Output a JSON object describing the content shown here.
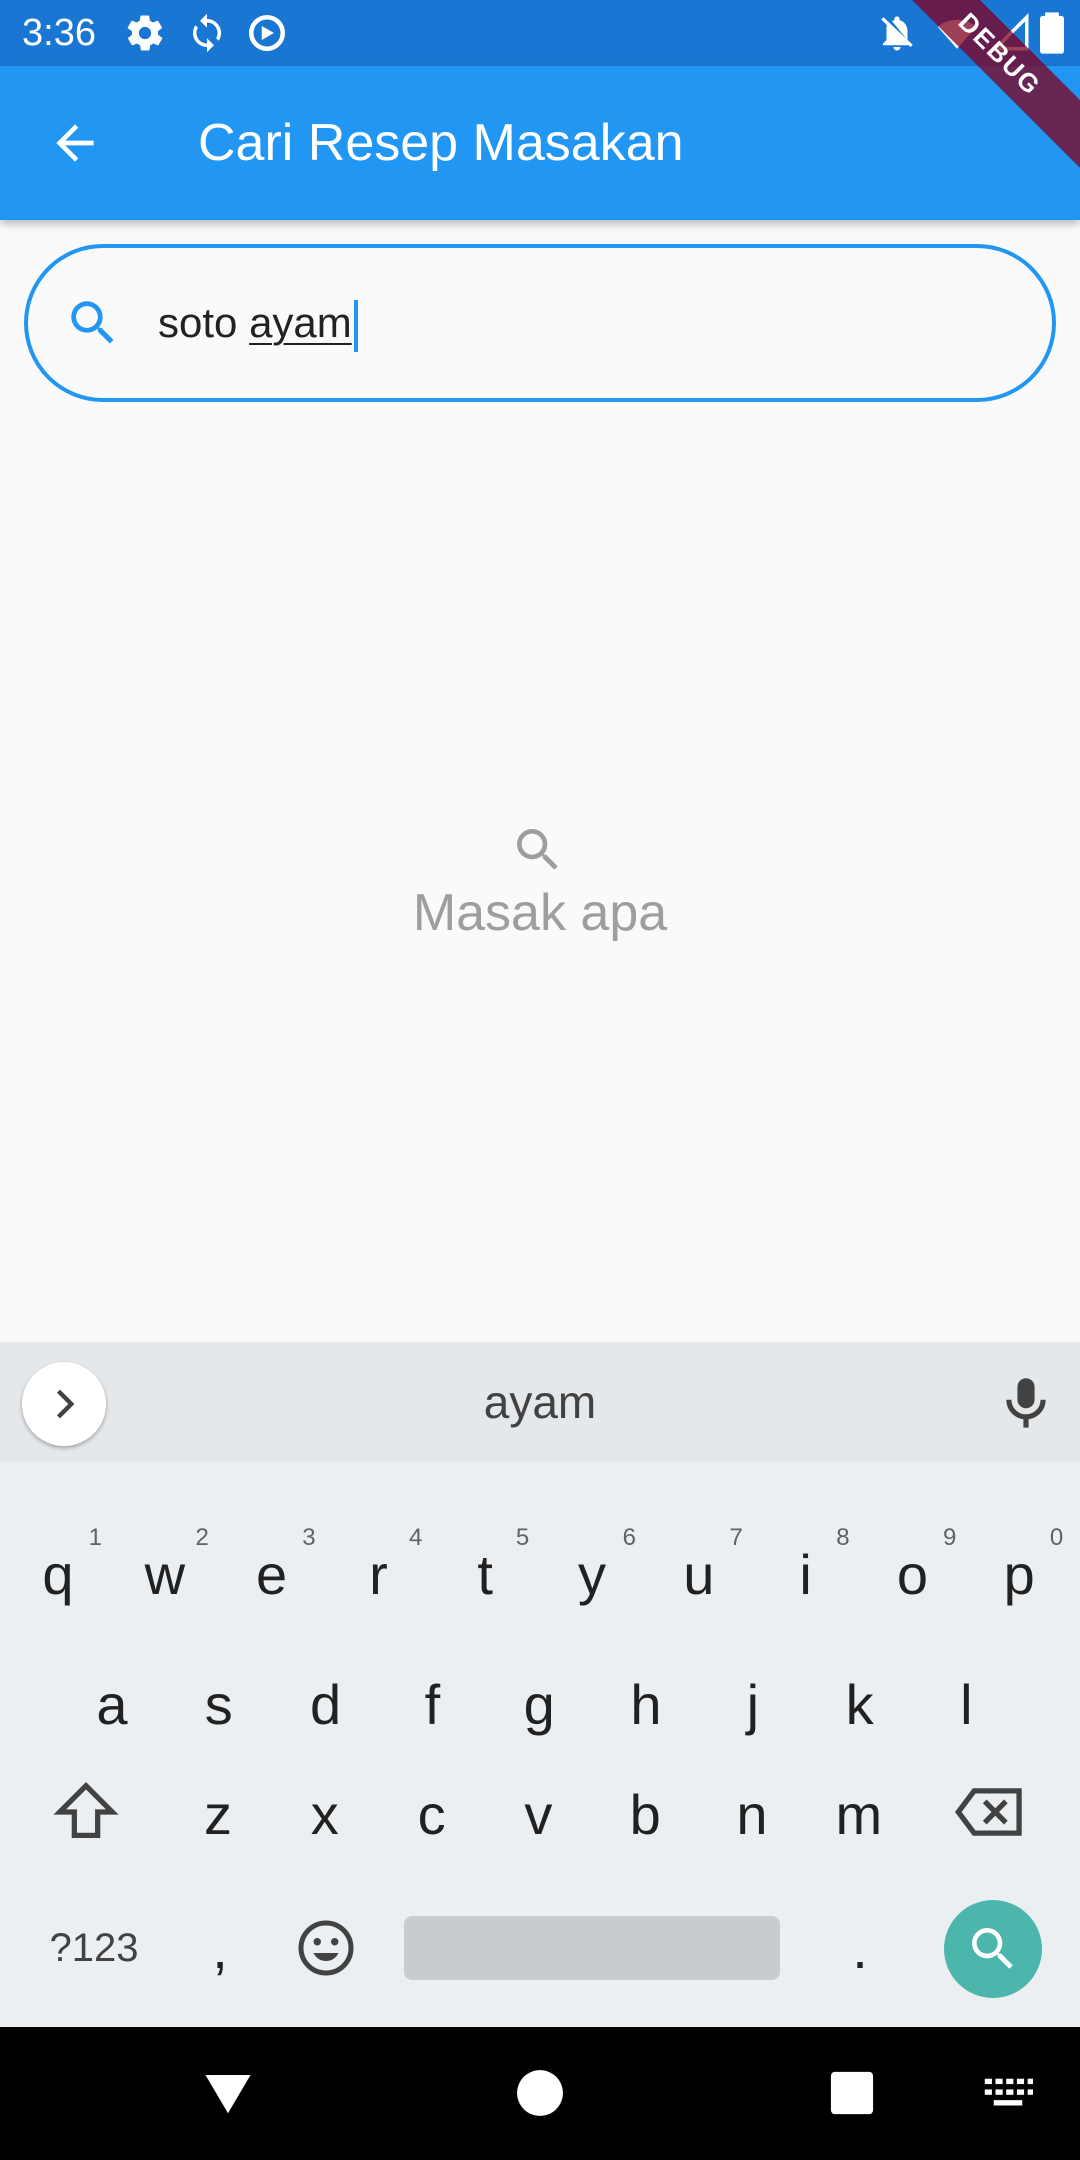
{
  "status_bar": {
    "time": "3:36",
    "left_icons": [
      "settings-icon",
      "sync-icon",
      "location-off-icon"
    ],
    "right_icons": [
      "notifications-off-icon",
      "wifi-icon",
      "signal-icon",
      "battery-icon"
    ]
  },
  "debug_banner": "DEBUG",
  "app_bar": {
    "title": "Cari Resep Masakan",
    "back_icon": "arrow-back-icon",
    "color": "#2196f3"
  },
  "search": {
    "value_plain": "soto ",
    "value_composing": "ayam",
    "icon": "search-icon",
    "accent": "#2196f3"
  },
  "empty_state": {
    "icon": "search-icon",
    "text": "Masak apa"
  },
  "keyboard": {
    "suggestion": "ayam",
    "row1": [
      {
        "k": "q",
        "h": "1"
      },
      {
        "k": "w",
        "h": "2"
      },
      {
        "k": "e",
        "h": "3"
      },
      {
        "k": "r",
        "h": "4"
      },
      {
        "k": "t",
        "h": "5"
      },
      {
        "k": "y",
        "h": "6"
      },
      {
        "k": "u",
        "h": "7"
      },
      {
        "k": "i",
        "h": "8"
      },
      {
        "k": "o",
        "h": "9"
      },
      {
        "k": "p",
        "h": "0"
      }
    ],
    "row2": [
      "a",
      "s",
      "d",
      "f",
      "g",
      "h",
      "j",
      "k",
      "l"
    ],
    "row3": [
      "z",
      "x",
      "c",
      "v",
      "b",
      "n",
      "m"
    ],
    "symbols_label": "?123",
    "comma": ",",
    "period": ".",
    "action_color": "#4db6ac"
  },
  "nav_bar": {
    "buttons": [
      "back-triangle-icon",
      "home-circle-icon",
      "recents-square-icon",
      "keyboard-switch-icon"
    ]
  }
}
